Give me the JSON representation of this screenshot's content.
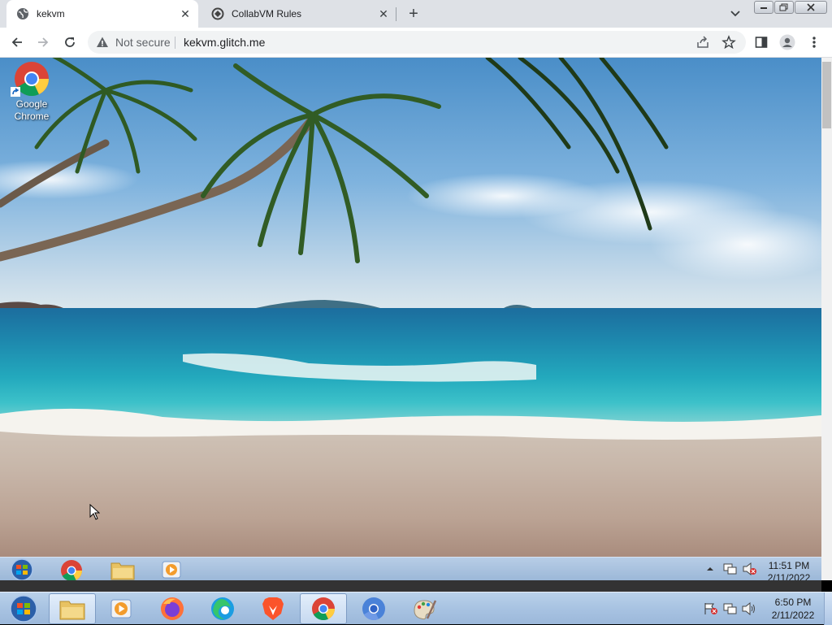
{
  "browser": {
    "tabs": [
      {
        "title": "kekvm",
        "active": true,
        "favicon": "globe-icon"
      },
      {
        "title": "CollabVM Rules",
        "active": false,
        "favicon": "collabvm-icon"
      }
    ],
    "address": {
      "security_label": "Not secure",
      "url": "kekvm.glitch.me"
    },
    "colors": {
      "tabstrip": "#dee1e6",
      "omnibox": "#f1f3f4"
    }
  },
  "desktop": {
    "icons": [
      {
        "label_line1": "Google",
        "label_line2": "Chrome",
        "icon": "chrome-icon"
      }
    ]
  },
  "vm_taskbar": {
    "time": "11:51 PM",
    "date": "2/11/2022",
    "items": [
      "start-orb",
      "chrome-icon",
      "explorer-icon",
      "media-player-icon"
    ]
  },
  "host_taskbar": {
    "time": "6:50 PM",
    "date": "2/11/2022",
    "items": [
      "start-orb",
      "explorer-icon",
      "media-player-icon",
      "firefox-icon",
      "edge-icon",
      "brave-icon",
      "chrome-icon",
      "chromium-icon",
      "paint-icon"
    ],
    "active_item": "chrome-icon"
  }
}
